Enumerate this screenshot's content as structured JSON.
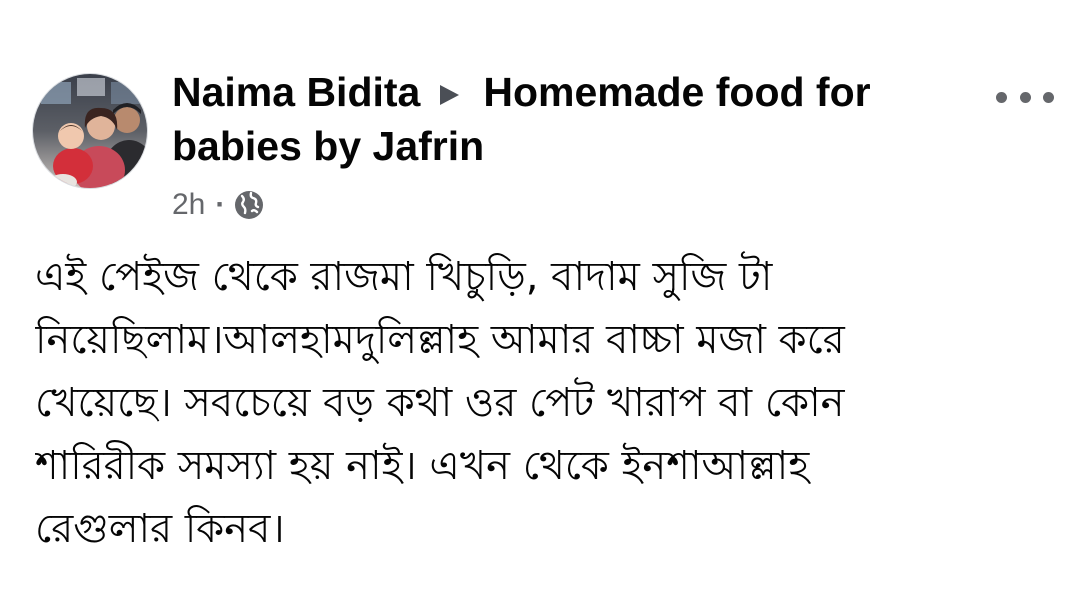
{
  "post": {
    "avatar_icon": "profile-photo",
    "author_name": "Naima Bidita",
    "arrow_icon": "triangle-right-icon",
    "group_name": "Homemade food for babies by Jafrin",
    "timestamp": "2h",
    "separator": "·",
    "audience_icon": "globe-icon",
    "more_icon": "more-horizontal-icon",
    "body_lines": [
      "এই পেইজ থেকে রাজমা খিচুড়ি, বাদাম সুজি টা",
      "নিয়েছিলাম।আলহামদুলিল্লাহ আমার বাচ্চা মজা করে",
      "খেয়েছে। সবচেয়ে বড় কথা ওর পেট খারাপ বা কোন",
      "শারিরীক সমস্যা হয় নাই। এখন থেকে ইনশাআল্লাহ",
      "রেগুলার কিনব।"
    ]
  },
  "colors": {
    "background": "#ffffff",
    "primary_text": "#050505",
    "secondary_text": "#65676b",
    "arrow": "#4b4f56"
  }
}
